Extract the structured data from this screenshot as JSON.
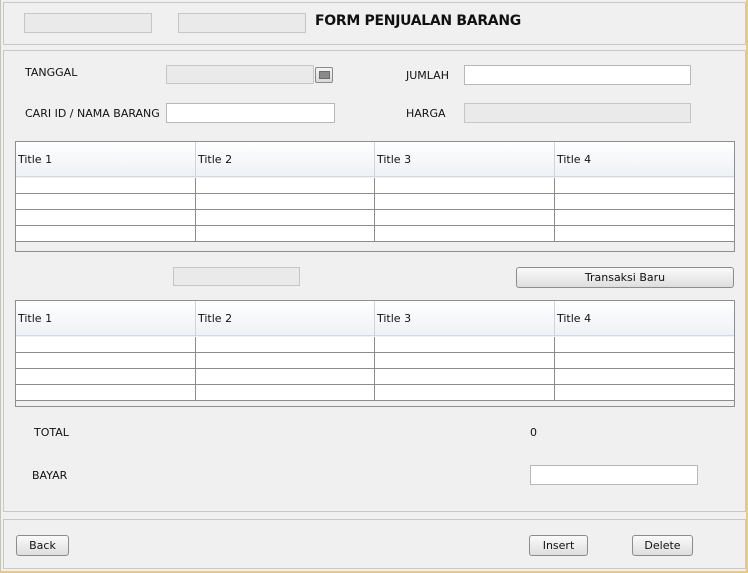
{
  "header": {
    "title": "FORM PENJUALAN BARANG",
    "field_1_value": "",
    "field_2_value": ""
  },
  "form": {
    "tanggal_label": "TANGGAL",
    "tanggal_value": "",
    "cari_label": "CARI ID / NAMA BARANG",
    "cari_value": "",
    "jumlah_label": "JUMLAH",
    "jumlah_value": "",
    "harga_label": "HARGA",
    "harga_value": ""
  },
  "table1": {
    "columns": [
      "Title 1",
      "Title 2",
      "Title 3",
      "Title 4"
    ]
  },
  "middle": {
    "field_value": "",
    "transaksi_button": "Transaksi Baru"
  },
  "table2": {
    "columns": [
      "Title 1",
      "Title 2",
      "Title 3",
      "Title 4"
    ]
  },
  "summary": {
    "total_label": "TOTAL",
    "total_value": "0",
    "bayar_label": "BAYAR",
    "bayar_value": ""
  },
  "footer": {
    "back_button": "Back",
    "insert_button": "Insert",
    "delete_button": "Delete"
  },
  "icons": {
    "date_picker": "calendar-icon"
  }
}
